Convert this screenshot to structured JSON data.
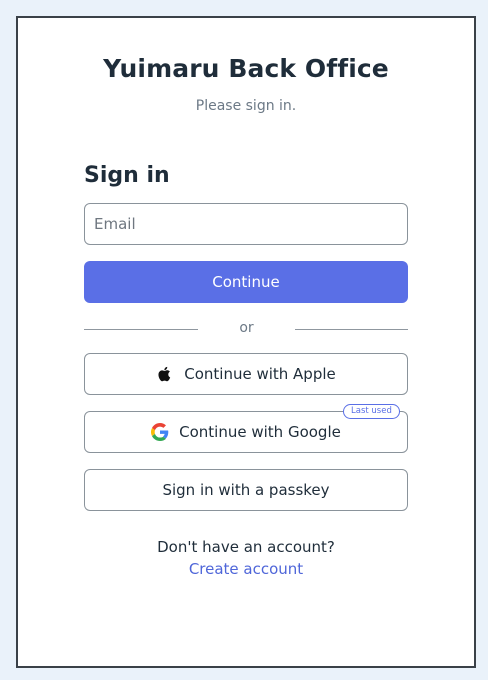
{
  "header": {
    "title": "Yuimaru Back Office",
    "subtitle": "Please sign in."
  },
  "form": {
    "heading": "Sign in",
    "email_placeholder": "Email",
    "continue_label": "Continue",
    "divider_text": "or"
  },
  "social": {
    "apple_label": "Continue with Apple",
    "google_label": "Continue with Google",
    "google_badge": "Last used",
    "passkey_label": "Sign in with a passkey"
  },
  "footer": {
    "prompt": "Don't have an account?",
    "create_link": "Create account"
  },
  "colors": {
    "accent": "#5a6fe6",
    "link": "#4f66d9",
    "background": "#eaf2fa"
  },
  "icons": {
    "apple": "apple-icon",
    "google": "google-icon"
  }
}
